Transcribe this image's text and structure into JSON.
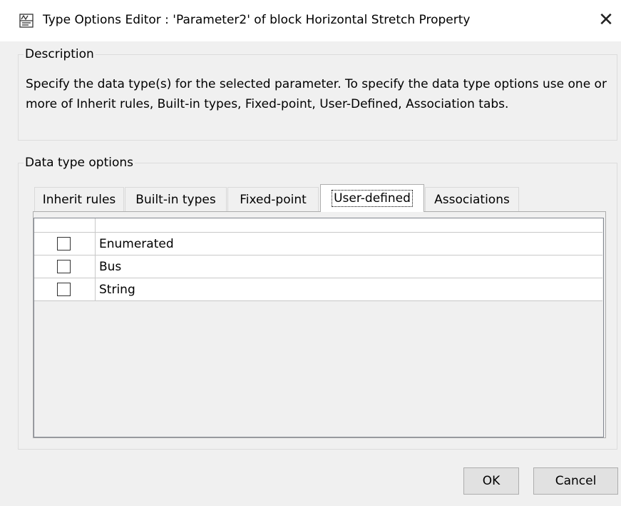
{
  "window": {
    "title": "Type Options Editor : 'Parameter2' of block Horizontal Stretch Property",
    "icon": "simulink-block-icon",
    "close_glyph": "✕"
  },
  "description": {
    "legend": "Description",
    "text": "Specify the data type(s) for the selected parameter. To specify the data type options use one or more of Inherit rules, Built-in types, Fixed-point, User-Defined, Association tabs."
  },
  "data_type_options": {
    "legend": "Data type options",
    "tabs": [
      {
        "label": "Inherit rules",
        "active": false
      },
      {
        "label": "Built-in types",
        "active": false
      },
      {
        "label": "Fixed-point",
        "active": false
      },
      {
        "label": "User-defined",
        "active": true
      },
      {
        "label": "Associations",
        "active": false
      }
    ],
    "rows": [
      {
        "label": "Enumerated",
        "checked": false
      },
      {
        "label": "Bus",
        "checked": false
      },
      {
        "label": "String",
        "checked": false
      }
    ]
  },
  "buttons": {
    "ok": "OK",
    "cancel": "Cancel"
  },
  "colors": {
    "dialog_bg": "#f0f0f0",
    "titlebar_bg": "#ffffff",
    "button_bg": "#e1e1e1"
  }
}
